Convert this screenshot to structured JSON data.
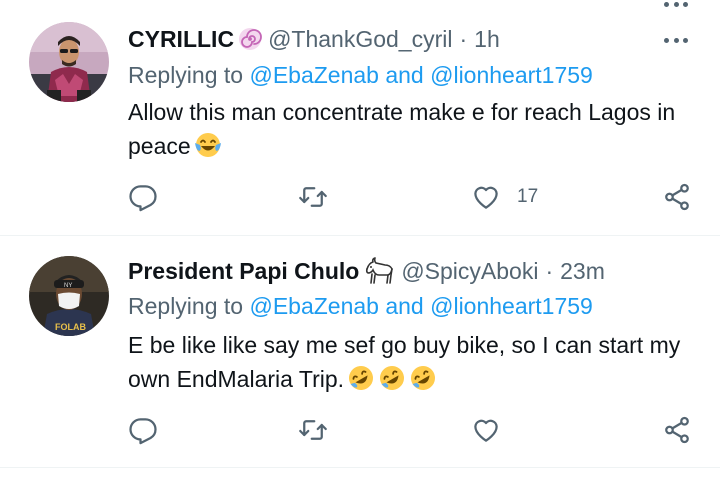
{
  "tweets": [
    {
      "display_name": "CYRILLIC",
      "name_emoji": "swirl-emoji",
      "handle": "@ThankGod_cyril",
      "separator": "·",
      "time": "1h",
      "replying_prefix": "Replying to",
      "replying_to": "@EbaZenab and @lionheart1759",
      "text": "Allow this man concentrate make e for reach Lagos in peace",
      "text_emojis": [
        "tears-of-joy-emoji"
      ],
      "likes": "17",
      "avatar_icon": "user-avatar-sunglasses"
    },
    {
      "display_name": "President Papi Chulo",
      "name_emoji": "goat-emoji",
      "handle": "@SpicyAboki",
      "separator": "·",
      "time": "23m",
      "replying_prefix": "Replying to",
      "replying_to": "@EbaZenab and @lionheart1759",
      "text": "E be like like say me sef go buy bike, so I can start my own EndMalaria Trip.",
      "text_emojis": [
        "rolling-laughing-emoji",
        "rolling-laughing-emoji",
        "rolling-laughing-emoji"
      ],
      "likes": "",
      "avatar_icon": "user-avatar-cap-mask"
    }
  ],
  "colors": {
    "text_primary": "#0f1419",
    "text_secondary": "#536471",
    "link": "#1d9bf0",
    "divider": "#eff3f4",
    "emoji_yellow": "#ffcc4d"
  },
  "icons": {
    "reply": "reply-icon",
    "retweet": "retweet-icon",
    "like": "heart-icon",
    "share": "share-icon",
    "more": "more-icon"
  }
}
